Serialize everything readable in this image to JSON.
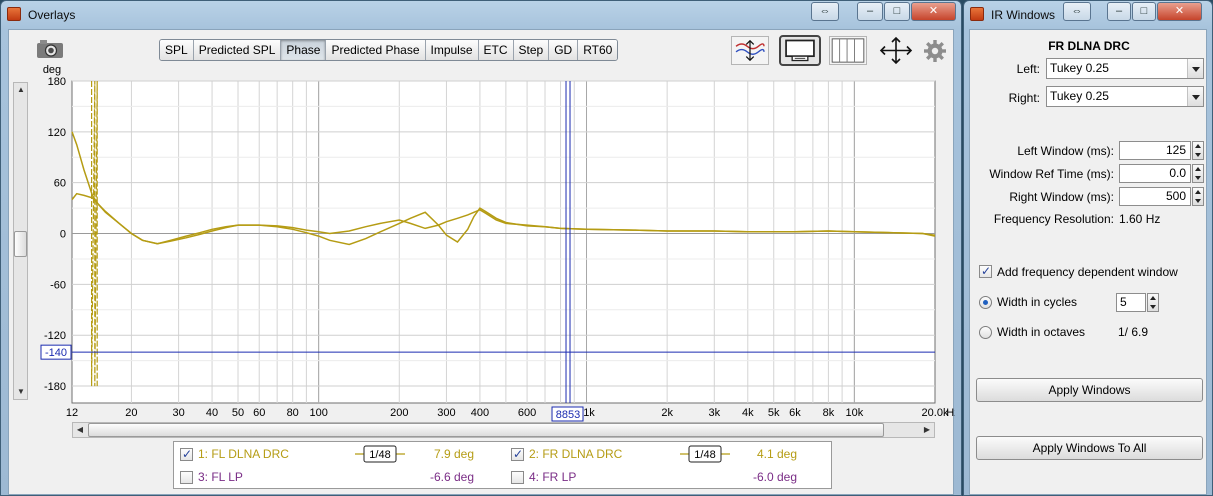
{
  "overlays_window": {
    "title": "Overlays",
    "title_buttons": [
      "⇔",
      "–",
      "□",
      "✕"
    ],
    "tabs": [
      {
        "label": "SPL",
        "active": false
      },
      {
        "label": "Predicted SPL",
        "active": false
      },
      {
        "label": "Phase",
        "active": true
      },
      {
        "label": "Predicted Phase",
        "active": false
      },
      {
        "label": "Impulse",
        "active": false
      },
      {
        "label": "ETC",
        "active": false
      },
      {
        "label": "Step",
        "active": false
      },
      {
        "label": "GD",
        "active": false
      },
      {
        "label": "RT60",
        "active": false
      }
    ],
    "toolbar_icons": [
      "trace-arrange-icon",
      "legend-display-icon",
      "panel-grid-icon",
      "zoom-expand-icon",
      "settings-gear-icon"
    ],
    "cursor_readouts": {
      "y": "-140",
      "x": "8853"
    },
    "legend": [
      {
        "id": "1",
        "label": "1: FL DLNA DRC",
        "checked": true,
        "smoothing": "1/48",
        "value": "7.9 deg",
        "color": "#b59c14"
      },
      {
        "id": "2",
        "label": "2: FR DLNA DRC",
        "checked": true,
        "smoothing": "1/48",
        "value": "4.1 deg",
        "color": "#b59c14"
      },
      {
        "id": "3",
        "label": "3: FL LP",
        "checked": false,
        "smoothing": "",
        "value": "-6.6 deg",
        "color": "#7a2d86"
      },
      {
        "id": "4",
        "label": "4: FR LP",
        "checked": false,
        "smoothing": "",
        "value": "-6.0 deg",
        "color": "#7a2d86"
      }
    ]
  },
  "chart_data": {
    "type": "line",
    "ylabel": "deg",
    "xlabel": "Hz",
    "x_scale": "log",
    "xlim": [
      12,
      20000
    ],
    "ylim": [
      -200,
      180
    ],
    "yticks": [
      180,
      120,
      60,
      0,
      -60,
      -120,
      -180
    ],
    "xticks": [
      {
        "v": 12,
        "label": "12"
      },
      {
        "v": 20,
        "label": "20"
      },
      {
        "v": 30,
        "label": "30"
      },
      {
        "v": 40,
        "label": "40"
      },
      {
        "v": 50,
        "label": "50"
      },
      {
        "v": 60,
        "label": "60"
      },
      {
        "v": 80,
        "label": "80"
      },
      {
        "v": 100,
        "label": "100"
      },
      {
        "v": 200,
        "label": "200"
      },
      {
        "v": 300,
        "label": "300"
      },
      {
        "v": 400,
        "label": "400"
      },
      {
        "v": 600,
        "label": "600"
      },
      {
        "v": 1000,
        "label": "1k"
      },
      {
        "v": 2000,
        "label": "2k"
      },
      {
        "v": 3000,
        "label": "3k"
      },
      {
        "v": 4000,
        "label": "4k"
      },
      {
        "v": 5000,
        "label": "5k"
      },
      {
        "v": 6000,
        "label": "6k"
      },
      {
        "v": 8000,
        "label": "8k"
      },
      {
        "v": 10000,
        "label": "10k"
      },
      {
        "v": 20000,
        "label": "20.0k"
      }
    ],
    "cursor": {
      "x": 853,
      "y": -140
    },
    "series": [
      {
        "name": "1: FL DLNA DRC",
        "color": "#b59c14",
        "x": [
          12,
          12.5,
          13.3,
          14.3,
          15,
          16,
          18,
          20,
          22,
          25,
          28,
          32,
          36,
          40,
          45,
          50,
          60,
          70,
          80,
          90,
          100,
          110,
          130,
          150,
          170,
          200,
          220,
          250,
          280,
          300,
          330,
          360,
          380,
          400,
          420,
          460,
          500,
          600,
          700,
          800,
          1000,
          1500,
          2000,
          3000,
          4000,
          6000,
          8000,
          10000,
          14000,
          18000,
          20000
        ],
        "y": [
          120,
          105,
          75,
          45,
          35,
          25,
          12,
          0,
          -8,
          -12,
          -9,
          -5,
          -1,
          3,
          7,
          10,
          10,
          8,
          5,
          1,
          -3,
          -8,
          -13,
          -6,
          2,
          12,
          18,
          25,
          10,
          -2,
          -10,
          5,
          20,
          30,
          26,
          18,
          13,
          9,
          8,
          6,
          5,
          4,
          3,
          3,
          2,
          2,
          3,
          2,
          1,
          0,
          -3
        ]
      },
      {
        "name": "2: FR DLNA DRC",
        "color": "#b59c14",
        "x": [
          12,
          12.5,
          13.3,
          14.3,
          15,
          16,
          18,
          20,
          22,
          25,
          28,
          32,
          36,
          40,
          45,
          50,
          60,
          70,
          80,
          90,
          100,
          110,
          130,
          150,
          170,
          200,
          220,
          250,
          280,
          300,
          330,
          360,
          380,
          400,
          420,
          460,
          500,
          600,
          700,
          800,
          1000,
          1500,
          2000,
          3000,
          4000,
          6000,
          8000,
          10000,
          14000,
          18000,
          20000
        ],
        "y": [
          40,
          47,
          45,
          42,
          35,
          26,
          12,
          0,
          -8,
          -12,
          -8,
          -3,
          1,
          5,
          8,
          10,
          10,
          9,
          7,
          4,
          2,
          0,
          3,
          8,
          12,
          16,
          12,
          6,
          10,
          14,
          18,
          22,
          25,
          28,
          24,
          16,
          12,
          10,
          8,
          6,
          5,
          4,
          3,
          3,
          2,
          2,
          3,
          2,
          1,
          0,
          -2
        ]
      },
      {
        "name": "wrap-spike",
        "color": "#b59c14",
        "x": [
          14.2,
          14.2,
          14.6,
          14.6,
          14.9,
          14.9
        ],
        "y": [
          180,
          -180,
          180,
          -180,
          180,
          -180
        ]
      }
    ]
  },
  "ir_windows": {
    "title": "IR Windows",
    "title_buttons": [
      "⇔",
      "–",
      "□",
      "✕"
    ],
    "measurement_name": "FR DLNA DRC",
    "left_label": "Left:",
    "left_value": "Tukey 0.25",
    "right_label": "Right:",
    "right_value": "Tukey 0.25",
    "left_window_label": "Left Window (ms):",
    "left_window_value": "125",
    "ref_time_label": "Window Ref Time (ms):",
    "ref_time_value": "0.0",
    "right_window_label": "Right Window (ms):",
    "right_window_value": "500",
    "freq_res_label": "Frequency Resolution:",
    "freq_res_value": "1.60 Hz",
    "fdw_label": "Add frequency dependent window",
    "fdw_checked": true,
    "cycles_label": "Width in cycles",
    "cycles_value": "5",
    "octaves_label": "Width in octaves",
    "octaves_value": "1/ 6.9",
    "apply_label": "Apply Windows",
    "apply_all_label": "Apply Windows To All"
  }
}
